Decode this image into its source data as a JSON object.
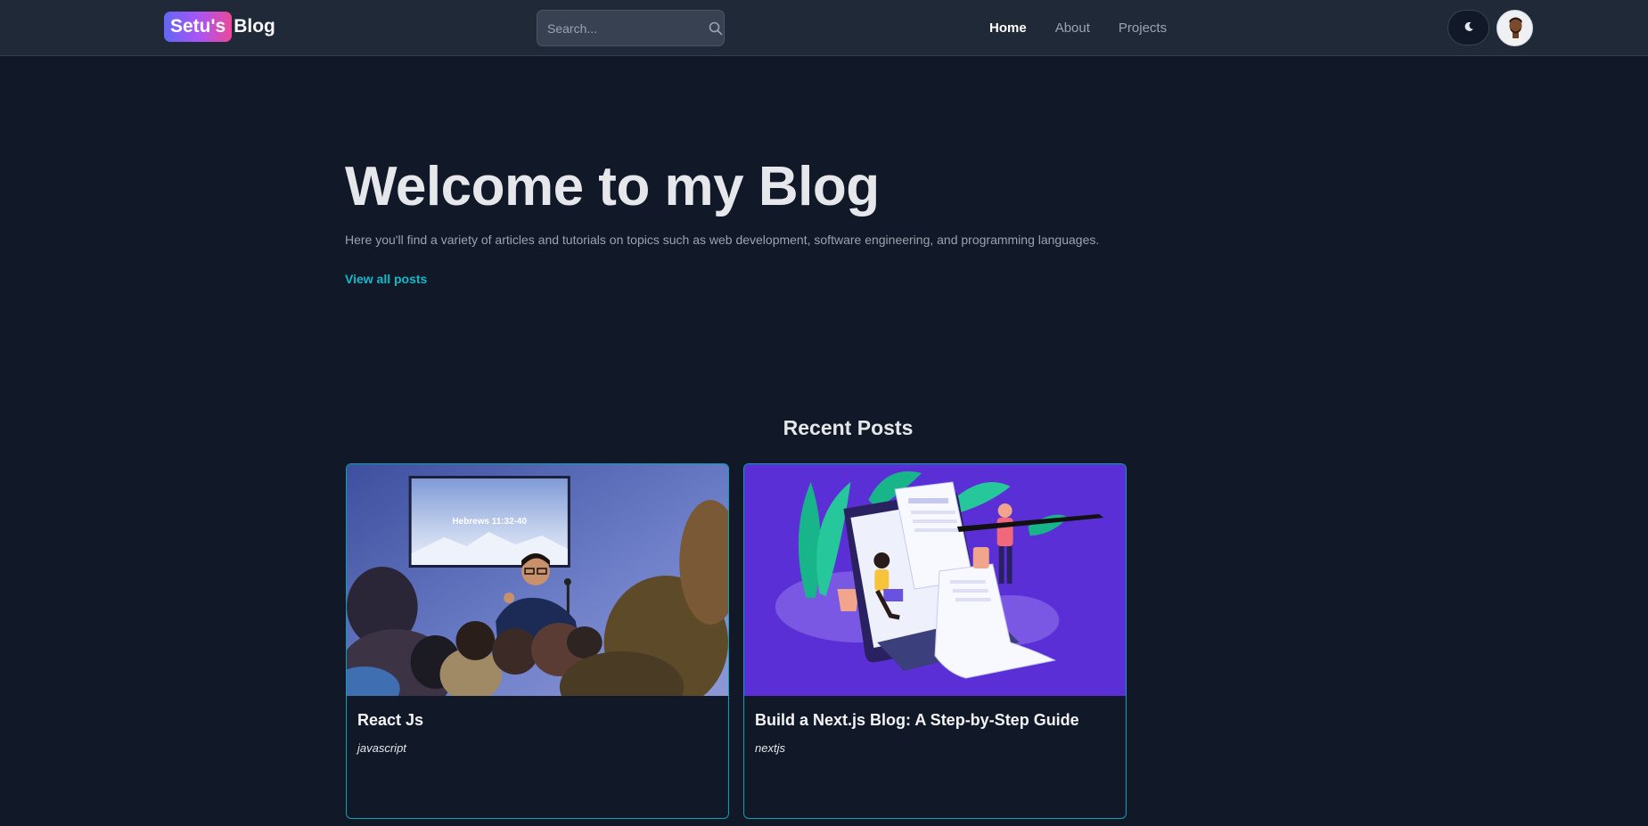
{
  "header": {
    "logo_highlight": "Setu's",
    "logo_rest": "Blog",
    "search_placeholder": "Search...",
    "nav": [
      {
        "label": "Home",
        "active": true
      },
      {
        "label": "About",
        "active": false
      },
      {
        "label": "Projects",
        "active": false
      }
    ],
    "theme_icon": "moon-icon",
    "avatar_icon": "user-avatar"
  },
  "hero": {
    "title": "Welcome to my Blog",
    "subtitle": "Here you'll find a variety of articles and tutorials on topics such as web development, software engineering, and programming languages.",
    "cta": "View all posts"
  },
  "recent": {
    "heading": "Recent Posts",
    "posts": [
      {
        "title": "React Js",
        "tag": "javascript",
        "image": "conference-speaker-photo",
        "screen_text": "Hebrews 11:32-40"
      },
      {
        "title": "Build a Next.js Blog: A Step-by-Step Guide",
        "tag": "nextjs",
        "image": "blog-writing-illustration"
      }
    ]
  },
  "colors": {
    "background": "#111827",
    "header_bg": "#1f2937",
    "accent": "#14b8c8",
    "card_border": "#0e9fb4",
    "illustration_bg": "#5b2fd6"
  }
}
